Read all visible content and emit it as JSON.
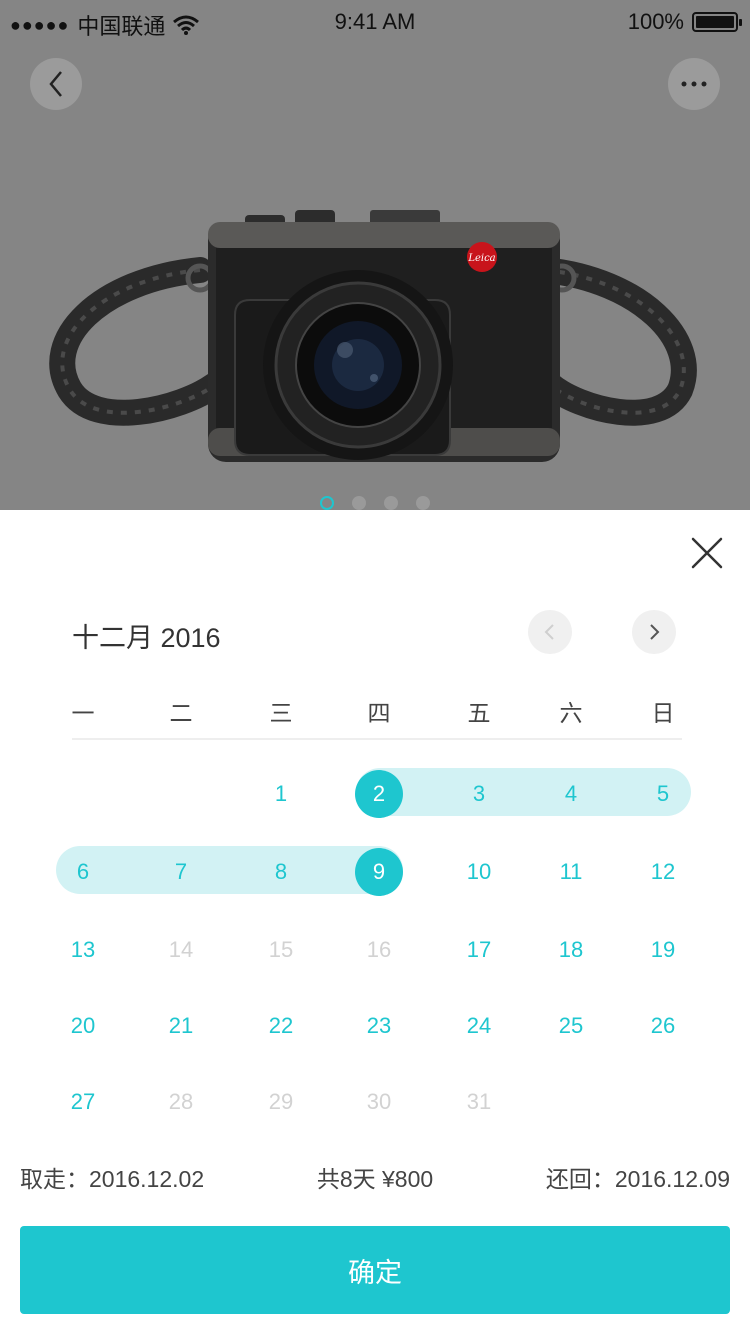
{
  "status_bar": {
    "signal_dots": "●●●●●",
    "carrier": "中国联通",
    "time": "9:41 AM",
    "battery_percent": "100%"
  },
  "hero": {
    "camera_brand": "Leica",
    "pager_count": 4,
    "pager_active": 0
  },
  "calendar": {
    "month_title": "十二月 2016",
    "weekdays": [
      "一",
      "二",
      "三",
      "四",
      "五",
      "六",
      "日"
    ],
    "days": [
      {
        "label": "1",
        "state": "available"
      },
      {
        "label": "2",
        "state": "selected"
      },
      {
        "label": "3",
        "state": "in-range"
      },
      {
        "label": "4",
        "state": "in-range"
      },
      {
        "label": "5",
        "state": "in-range"
      },
      {
        "label": "6",
        "state": "in-range"
      },
      {
        "label": "7",
        "state": "in-range"
      },
      {
        "label": "8",
        "state": "in-range"
      },
      {
        "label": "9",
        "state": "selected"
      },
      {
        "label": "10",
        "state": "available"
      },
      {
        "label": "11",
        "state": "available"
      },
      {
        "label": "12",
        "state": "available"
      },
      {
        "label": "13",
        "state": "available"
      },
      {
        "label": "14",
        "state": "disabled"
      },
      {
        "label": "15",
        "state": "disabled"
      },
      {
        "label": "16",
        "state": "disabled"
      },
      {
        "label": "17",
        "state": "available"
      },
      {
        "label": "18",
        "state": "available"
      },
      {
        "label": "19",
        "state": "available"
      },
      {
        "label": "20",
        "state": "available"
      },
      {
        "label": "21",
        "state": "available"
      },
      {
        "label": "22",
        "state": "available"
      },
      {
        "label": "23",
        "state": "available"
      },
      {
        "label": "24",
        "state": "available"
      },
      {
        "label": "25",
        "state": "available"
      },
      {
        "label": "26",
        "state": "available"
      },
      {
        "label": "27",
        "state": "available"
      },
      {
        "label": "28",
        "state": "disabled"
      },
      {
        "label": "29",
        "state": "disabled"
      },
      {
        "label": "30",
        "state": "disabled"
      },
      {
        "label": "31",
        "state": "disabled"
      }
    ]
  },
  "summary": {
    "pickup": "取走：2016.12.02",
    "total": "共8天 ¥800",
    "return": "还回：2016.12.09"
  },
  "confirm_label": "确定",
  "colors": {
    "accent": "#1ec6cf",
    "range_fill": "#d2f2f4",
    "disabled_text": "#d2d2d2",
    "hero_bg": "#858585"
  }
}
